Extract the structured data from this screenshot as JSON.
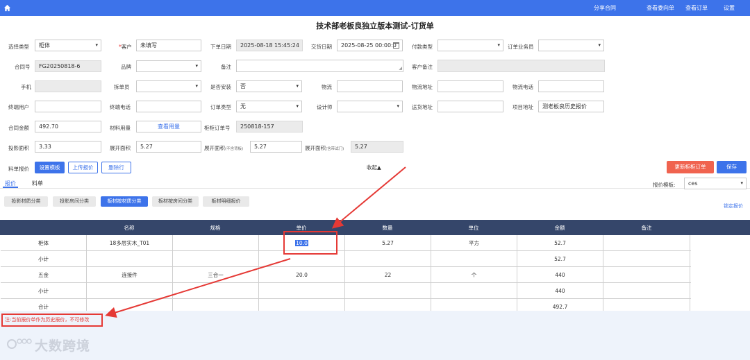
{
  "nav": {
    "links": [
      "分享合同",
      "查看委向单",
      "查看订单",
      "设置"
    ]
  },
  "page_title": "技术部老板良独立版本测试-订货单",
  "form": {
    "select_type": {
      "label": "选择类型",
      "value": "柜体"
    },
    "customer": {
      "label_req": "*",
      "label": "客户",
      "value": "未填写"
    },
    "order_date": {
      "label": "下单日期",
      "value": "2025-08-18 15:45:24"
    },
    "delivery_date": {
      "label": "交货日期",
      "value": "2025-08-25 00:00:0"
    },
    "payment_type": {
      "label": "付款类型",
      "value": ""
    },
    "salesperson": {
      "label": "订单业务员",
      "value": ""
    },
    "contract_no": {
      "label": "合同号",
      "value": "FG20250818-6"
    },
    "brand": {
      "label": "品牌",
      "value": ""
    },
    "remark": {
      "label": "备注",
      "value": ""
    },
    "customer_remark": {
      "label": "客户备注",
      "value": ""
    },
    "phone": {
      "label": "手机",
      "value": ""
    },
    "splitter": {
      "label": "拆单员",
      "value": ""
    },
    "install": {
      "label": "是否安装",
      "value": "否"
    },
    "logistics": {
      "label": "物流",
      "value": ""
    },
    "logistics_addr": {
      "label": "物流地址",
      "value": ""
    },
    "logistics_phone": {
      "label": "物流电话",
      "value": ""
    },
    "end_user": {
      "label": "终端用户",
      "value": ""
    },
    "end_phone": {
      "label": "终端电话",
      "value": ""
    },
    "order_kind": {
      "label": "订单类型",
      "value": "无"
    },
    "designer": {
      "label": "设计师",
      "value": ""
    },
    "delivery_addr": {
      "label": "送货地址",
      "value": ""
    },
    "project_addr": {
      "label": "项目地址",
      "value": "测老板良历史报价"
    },
    "contract_amount": {
      "label": "合同金额",
      "value": "492.70"
    },
    "material_usage": {
      "label": "材料用量",
      "value": "查看用量"
    },
    "cabinet_order_no": {
      "label": "柜柜订单号",
      "value": "250818-157"
    },
    "projection_area": {
      "label": "投影面积",
      "value": "3.33"
    },
    "unfold_area1": {
      "label": "展开面积",
      "value": "5.27"
    },
    "unfold_area2": {
      "label": "展开面积",
      "label_small": "(不含背板)",
      "value": "5.27"
    },
    "unfold_area3": {
      "label": "展开面积",
      "label_small": "(含带试门)",
      "value": "5.27"
    }
  },
  "toolbar": {
    "quote_label": "料单报价",
    "set_template": "设置模板",
    "upload_quote": "上传报价",
    "delete_row": "删除行",
    "collapse": "收起▲",
    "update_order": "更新柜柜订单",
    "save": "保存"
  },
  "tabs": [
    "报价",
    "料单"
  ],
  "template": {
    "label": "报价模板:",
    "value": "ces"
  },
  "pills": [
    "投影材质分类",
    "投影房间分类",
    "板材按材质分类",
    "板材按房间分类",
    "板材明细报价"
  ],
  "lock_quote": "锁定报价",
  "table": {
    "headers": [
      "名称",
      "规格",
      "单价",
      "数量",
      "单位",
      "金额",
      "备注"
    ],
    "rows": [
      [
        "柜体",
        "18多层实木_T01",
        "",
        "10.0",
        "5.27",
        "平方",
        "52.7",
        ""
      ],
      [
        "小计",
        "",
        "",
        "",
        "",
        "",
        "52.7",
        ""
      ],
      [
        "五金",
        "连接件",
        "三合一",
        "20.0",
        "22",
        "个",
        "440",
        ""
      ],
      [
        "小计",
        "",
        "",
        "",
        "",
        "",
        "440",
        ""
      ],
      [
        "合计",
        "",
        "",
        "",
        "",
        "",
        "492.7",
        ""
      ]
    ]
  },
  "note": "注:当前报价单作为历史报价，不可修改",
  "watermark": "大数跨境",
  "colors": {
    "primary": "#3d73ea",
    "danger": "#f0634f",
    "header": "#35466a",
    "annotation": "#e53935"
  }
}
